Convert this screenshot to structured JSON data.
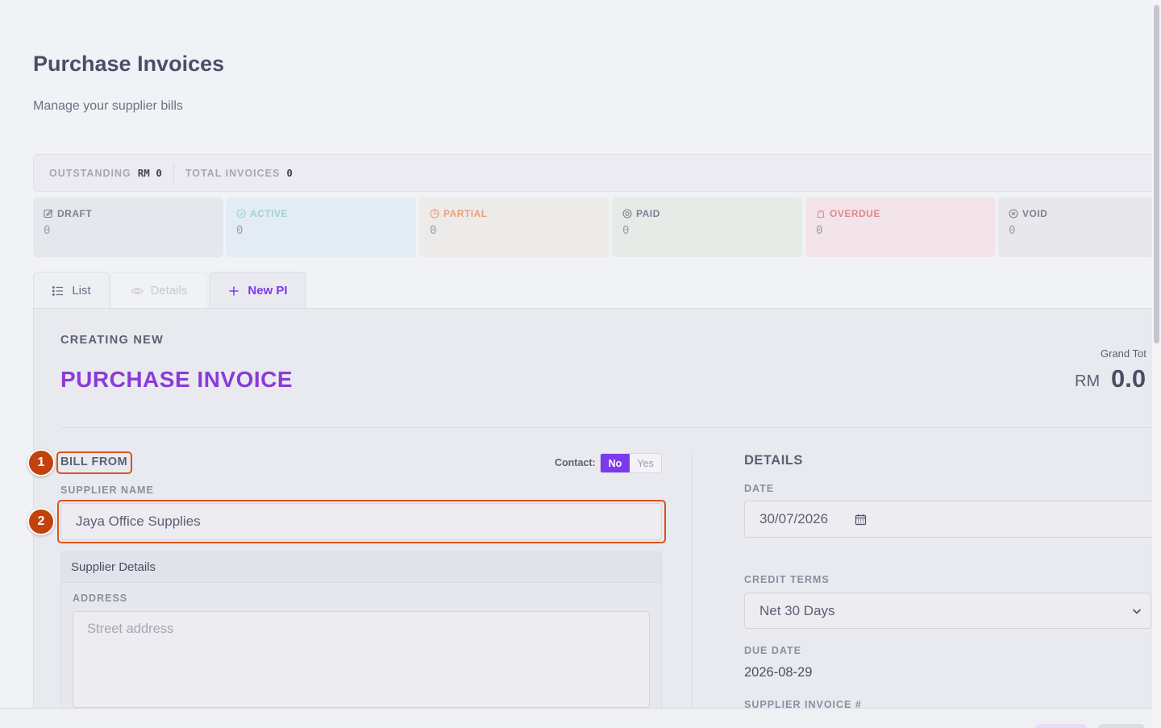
{
  "page": {
    "title": "Purchase Invoices",
    "subtitle": "Manage your supplier bills"
  },
  "summary": {
    "outstanding_label": "OUTSTANDING",
    "outstanding_value": "RM 0",
    "total_label": "TOTAL INVOICES",
    "total_value": "0"
  },
  "stats": [
    {
      "label": "DRAFT",
      "value": "0",
      "icon": "edit-icon",
      "color": "#7d8092",
      "bg": "#e6e7ec"
    },
    {
      "label": "ACTIVE",
      "value": "0",
      "icon": "check-circle-icon",
      "color": "#9fd3c9",
      "bg": "#e3ecf4"
    },
    {
      "label": "PARTIAL",
      "value": "0",
      "icon": "pie-clock-icon",
      "color": "#e8a07c",
      "bg": "#edebea"
    },
    {
      "label": "PAID",
      "value": "0",
      "icon": "target-icon",
      "color": "#7d8092",
      "bg": "#e7ebe8"
    },
    {
      "label": "OVERDUE",
      "value": "0",
      "icon": "alarm-icon",
      "color": "#e0878e",
      "bg": "#f2e4e8"
    },
    {
      "label": "VOID",
      "value": "0",
      "icon": "x-circle-icon",
      "color": "#7d8092",
      "bg": "#e8e8ec"
    }
  ],
  "tabs": {
    "list": "List",
    "details": "Details",
    "new": "New PI"
  },
  "form": {
    "creating_label": "CREATING NEW",
    "doc_title": "PURCHASE INVOICE",
    "grand_total_label": "Grand Tot",
    "grand_total_currency": "RM",
    "grand_total_value": "0.0",
    "bill_from": "BILL FROM",
    "contact_label": "Contact:",
    "contact_no": "No",
    "contact_yes": "Yes",
    "supplier_name_label": "SUPPLIER NAME",
    "supplier_name_value": "Jaya Office Supplies",
    "supplier_details_title": "Supplier Details",
    "address_label": "ADDRESS",
    "address_placeholder": "Street address",
    "details_title": "DETAILS",
    "date_label": "DATE",
    "date_value": "30/07/2026",
    "credit_terms_label": "CREDIT TERMS",
    "credit_terms_value": "Net 30 Days",
    "due_date_label": "DUE DATE",
    "due_date_value": "2026-08-29",
    "supplier_invoice_label": "SUPPLIER INVOICE #"
  },
  "annotations": {
    "badge1": "1",
    "badge2": "2"
  },
  "colors": {
    "accent": "#7c3aed",
    "title_purple": "#8b3bd8",
    "highlight": "#d9531e",
    "badge": "#c2410c"
  }
}
